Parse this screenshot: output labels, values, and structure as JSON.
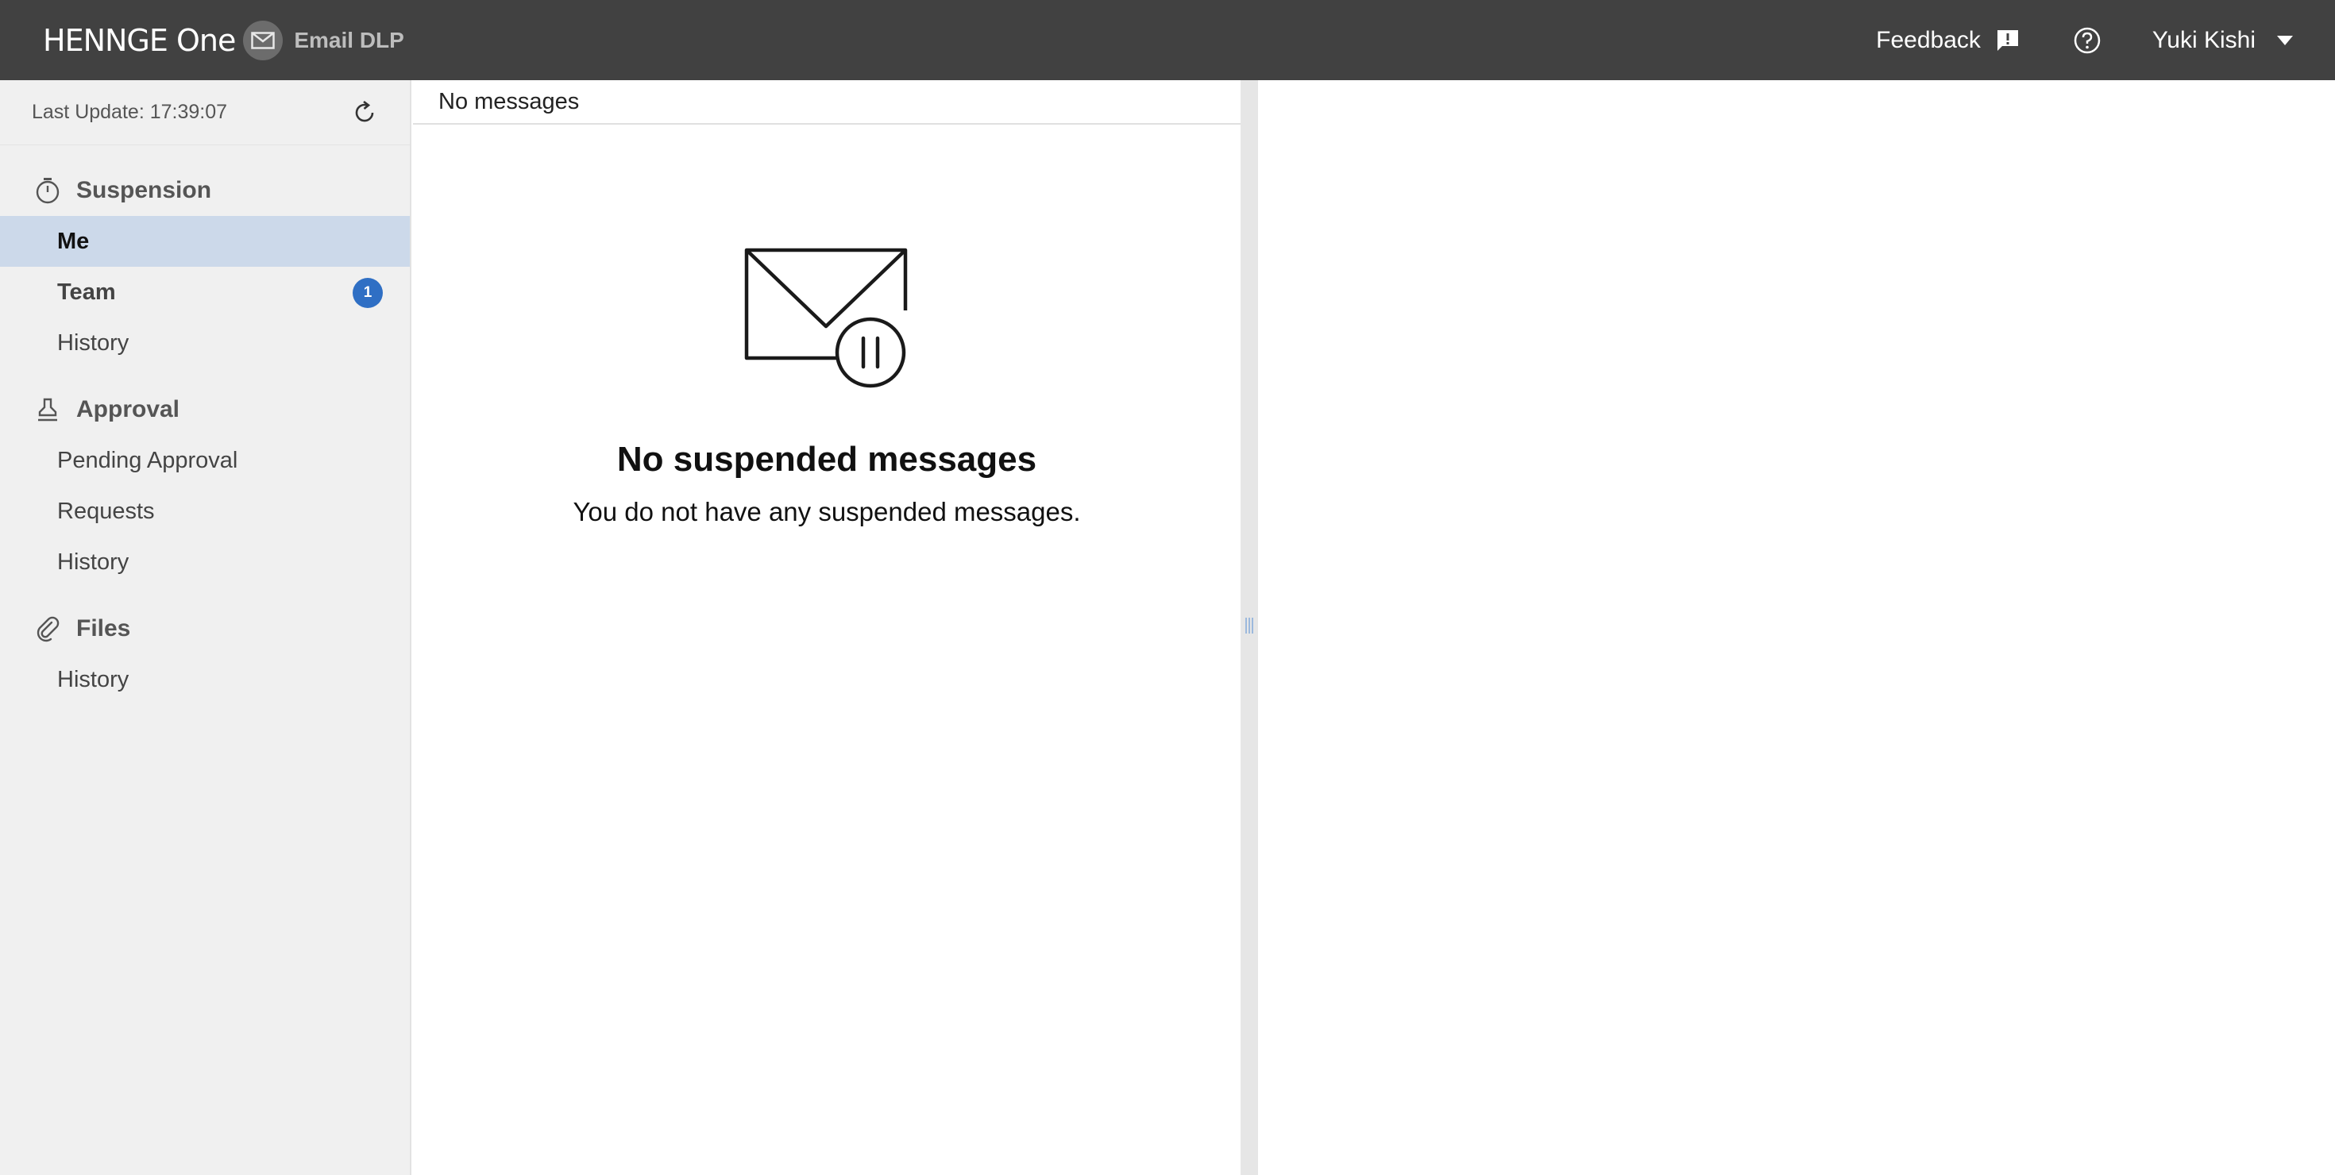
{
  "header": {
    "brand": "HENNGE One",
    "product": "Email DLP",
    "feedback_label": "Feedback",
    "user_name": "Yuki Kishi"
  },
  "sidebar": {
    "last_update": "Last Update: 17:39:07",
    "sections": [
      {
        "title": "Suspension",
        "icon": "stopwatch-icon",
        "items": [
          {
            "label": "Me",
            "active": true
          },
          {
            "label": "Team",
            "badge": "1"
          },
          {
            "label": "History"
          }
        ]
      },
      {
        "title": "Approval",
        "icon": "stamp-icon",
        "items": [
          {
            "label": "Pending Approval"
          },
          {
            "label": "Requests"
          },
          {
            "label": "History"
          }
        ]
      },
      {
        "title": "Files",
        "icon": "paperclip-icon",
        "items": [
          {
            "label": "History"
          }
        ]
      }
    ]
  },
  "list": {
    "header": "No messages",
    "empty_title": "No suspended messages",
    "empty_text": "You do not have any suspended messages."
  },
  "colors": {
    "topbar": "#414141",
    "active_item": "#ccd9ea",
    "badge": "#2f6fc4"
  }
}
